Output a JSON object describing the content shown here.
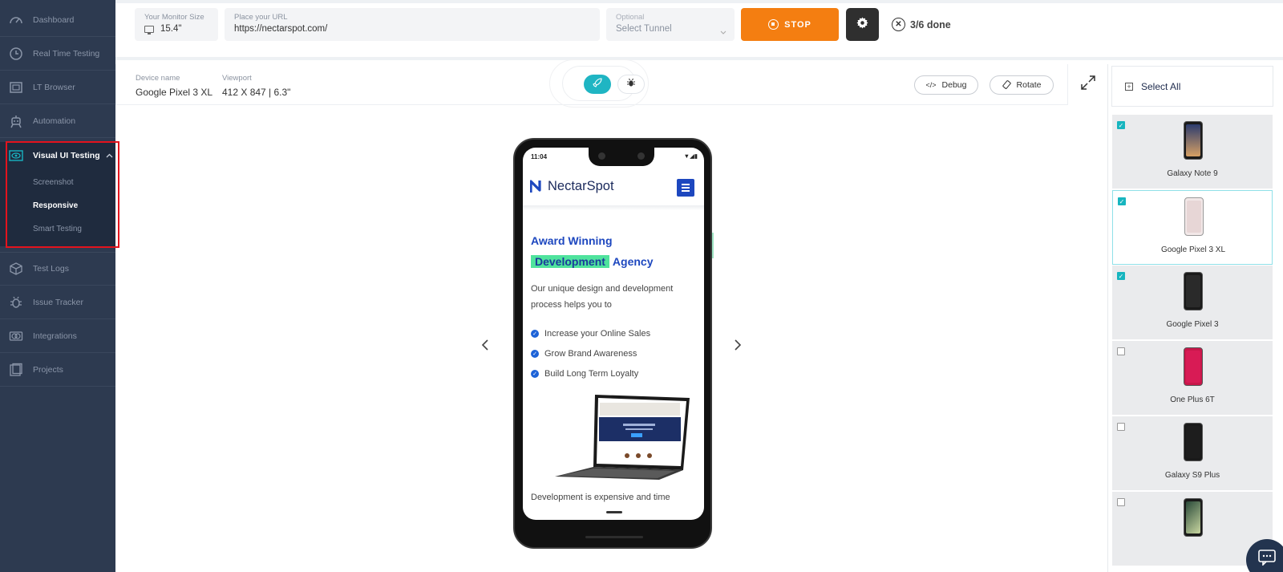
{
  "sidebar": {
    "items": [
      {
        "label": "Dashboard",
        "icon": "dashboard-gauge-icon"
      },
      {
        "label": "Real Time Testing",
        "icon": "clock-icon"
      },
      {
        "label": "LT Browser",
        "icon": "browser-icon"
      },
      {
        "label": "Automation",
        "icon": "robot-icon"
      }
    ],
    "group": {
      "label": "Visual UI Testing",
      "icon": "eye-icon",
      "subitems": [
        {
          "label": "Screenshot"
        },
        {
          "label": "Responsive"
        },
        {
          "label": "Smart Testing"
        }
      ]
    },
    "items_after": [
      {
        "label": "Test Logs",
        "icon": "cube-icon"
      },
      {
        "label": "Issue Tracker",
        "icon": "bug-icon"
      },
      {
        "label": "Integrations",
        "icon": "integrations-icon"
      },
      {
        "label": "Projects",
        "icon": "folder-icon"
      }
    ]
  },
  "toolbar": {
    "monitor_caption": "Your Monitor Size",
    "monitor_value": "15.4\"",
    "url_caption": "Place your URL",
    "url_value": "https://nectarspot.com/",
    "tunnel_caption": "Optional",
    "tunnel_value": "Select Tunnel",
    "stop_label": "STOP",
    "progress_text": "3/6 done"
  },
  "device_bar": {
    "device_caption": "Device name",
    "device_value": "Google Pixel 3 XL",
    "viewport_caption": "Viewport",
    "viewport_value": "412 X 847 | 6.3\"",
    "debug_label": "Debug",
    "rotate_label": "Rotate"
  },
  "phone": {
    "status_time": "11:04",
    "brand_name": "NectarSpot",
    "hero_line1": "Award Winning",
    "hero_highlight": "Development",
    "hero_line2_rest": "Agency",
    "description": "Our unique design and development process helps you to",
    "bullets": [
      "Increase your Online Sales",
      "Grow Brand Awareness",
      "Build Long Term Loyalty"
    ],
    "footer_text": "Development is expensive and time"
  },
  "right_panel": {
    "select_all_label": "Select All",
    "devices": [
      {
        "name": "Galaxy Note 9",
        "checked": true,
        "active": false
      },
      {
        "name": "Google Pixel 3 XL",
        "checked": true,
        "active": true
      },
      {
        "name": "Google Pixel 3",
        "checked": true,
        "active": false
      },
      {
        "name": "One Plus 6T",
        "checked": false,
        "active": false
      },
      {
        "name": "Galaxy S9 Plus",
        "checked": false,
        "active": false
      },
      {
        "name": "",
        "checked": false,
        "active": false
      }
    ]
  },
  "colors": {
    "sidebar_bg": "#2d3a50",
    "accent": "#19b4c2",
    "stop_orange": "#f47e11",
    "brand_blue": "#1d47bf",
    "highlight_green": "#4fe39d",
    "selection_red": "#e3131d"
  }
}
